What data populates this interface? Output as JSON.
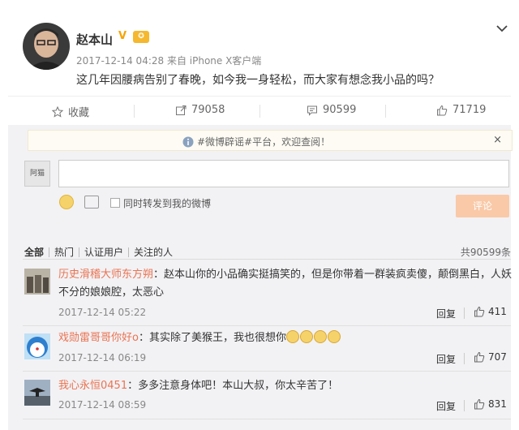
{
  "post": {
    "author": "赵本山",
    "verified_badge": "V",
    "level_badge": "✪",
    "meta": "2017-12-14 04:28 来自 iPhone X客户端",
    "text": "这几年因腰病告别了春晚，如今我一身轻松，而大家有想念我小品的吗？"
  },
  "actions": {
    "favorite_label": "收藏",
    "repost_count": "79058",
    "comment_count": "90599",
    "like_count": "71719"
  },
  "notice": {
    "text": "#微博辟谣#平台，欢迎查阅！",
    "close": "×"
  },
  "composer": {
    "avatar_text": "阿猫",
    "repost_label": "同时转发到我的微博",
    "submit_label": "评论"
  },
  "filters": {
    "tabs": [
      "全部",
      "热门",
      "认证用户",
      "关注的人"
    ],
    "total": "共90599条"
  },
  "comments": [
    {
      "user": "历史滑稽大师东方朔",
      "text": "：赵本山你的小品确实挺搞笑的，但是你带着一群装疯卖傻，颠倒黑白，人妖不分的娘娘腔，太恶心",
      "time": "2017-12-14 05:22",
      "reply": "回复",
      "likes": "411"
    },
    {
      "user": "戏勋雷哥哥你好o",
      "text": "：其实除了美猴王，我也很想你",
      "time": "2017-12-14 06:19",
      "reply": "回复",
      "likes": "707"
    },
    {
      "user": "我心永恒0451",
      "text": "：多多注意身体吧！本山大叔，你太辛苦了！",
      "time": "2017-12-14 08:59",
      "reply": "回复",
      "likes": "831"
    }
  ],
  "colors": {
    "username": "#eb7350",
    "submit_bg": "#f9c9a8",
    "panel_bg": "#f2f2f5"
  }
}
